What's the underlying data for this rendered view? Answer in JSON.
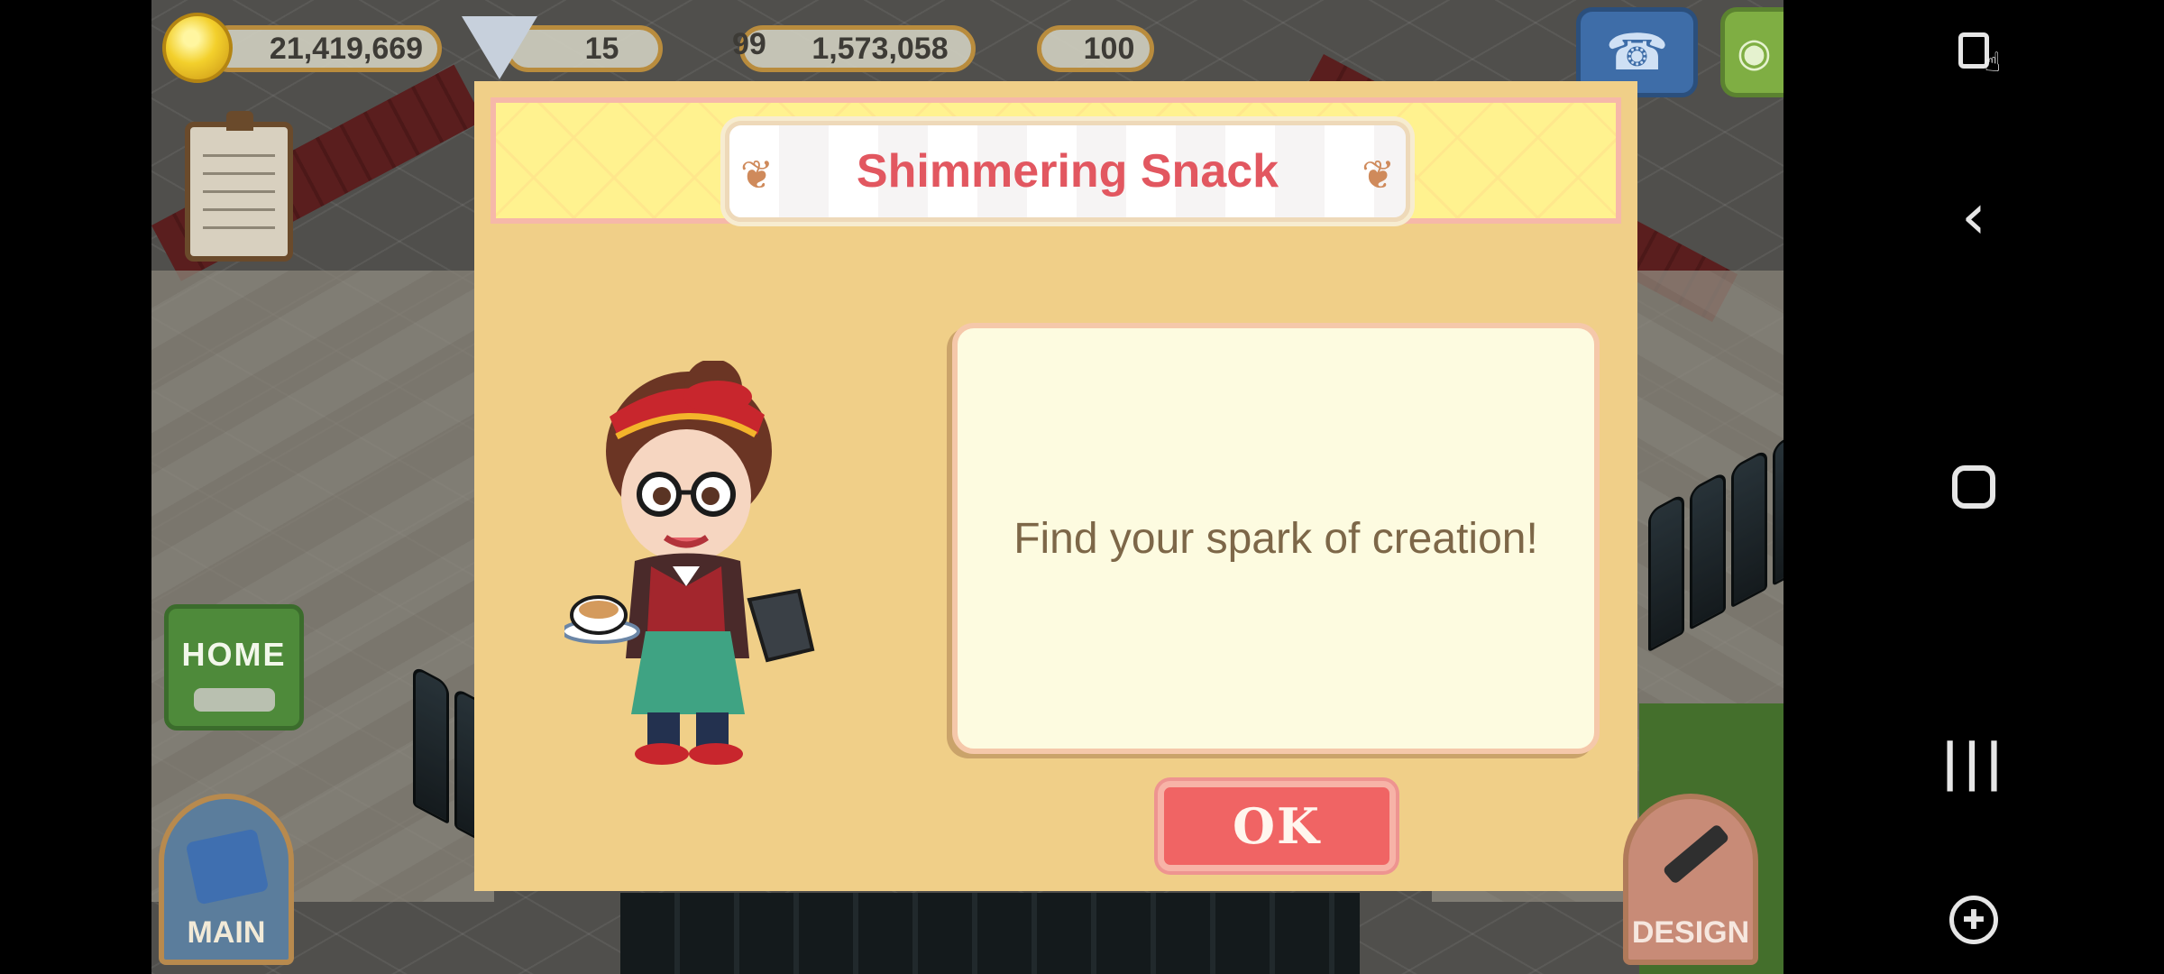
{
  "hud": {
    "coins": "21,419,669",
    "gems": "15",
    "level": "99",
    "stars": "1,573,058",
    "hearts": "100"
  },
  "side_buttons": {
    "home_label": "HOME",
    "main_label": "MAIN",
    "design_label": "DESIGN"
  },
  "dialog": {
    "title": "Shimmering Snack",
    "message": "Find your spark of creation!",
    "ok_label": "OK"
  },
  "icons": {
    "coin": "coin-icon",
    "gem": "gem-icon",
    "star": "star-icon",
    "heart": "heart-icon",
    "phone": "phone-icon",
    "camera": "camera-icon",
    "currency": "currency-icon",
    "clipboard": "clipboard-icon"
  },
  "colors": {
    "dialog_bg": "#f0cf88",
    "title_text": "#e25760",
    "ok_button": "#f06464",
    "message_text": "#7d6748"
  }
}
